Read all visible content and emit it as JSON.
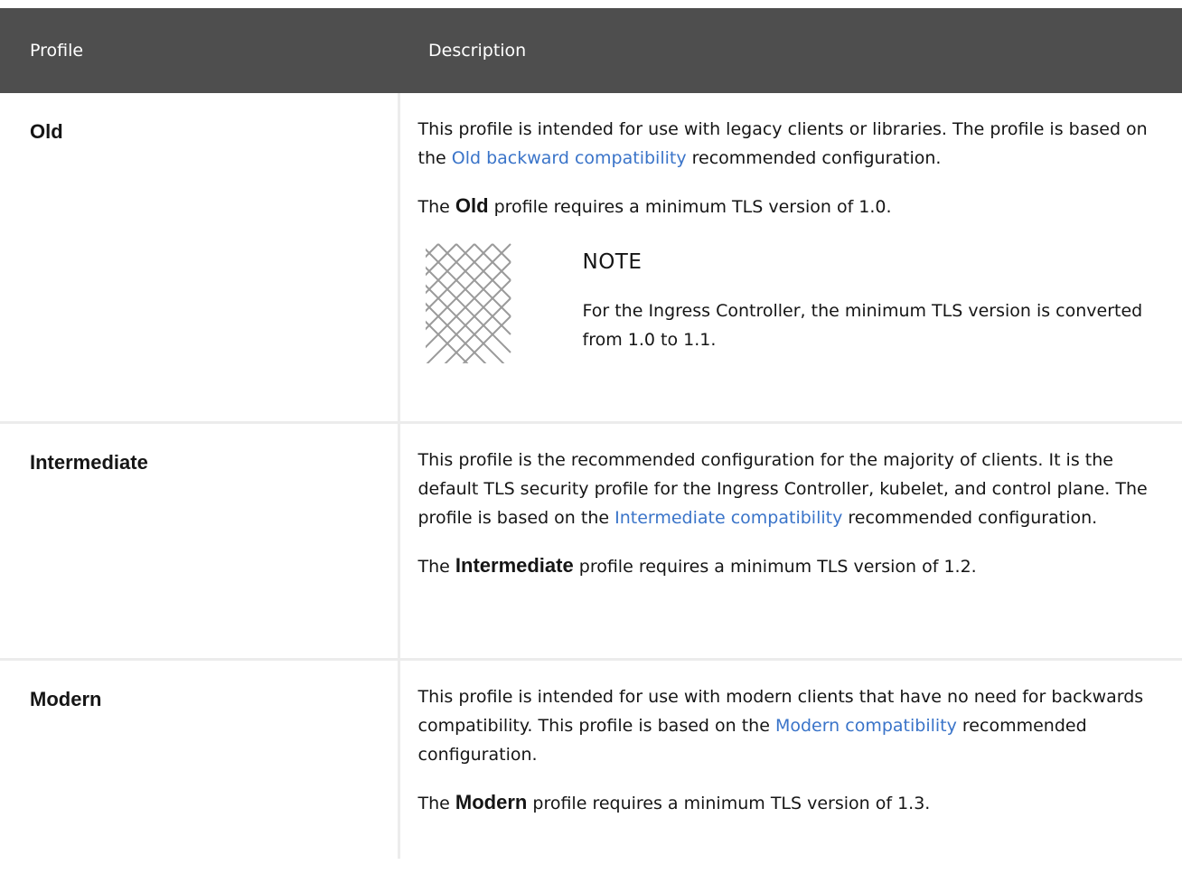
{
  "header": {
    "col_profile": "Profile",
    "col_description": "Description"
  },
  "rows": [
    {
      "profile": "Old",
      "para1_before": "This profile is intended for use with legacy clients or libraries. The profile is based on the ",
      "para1_link": "Old backward compatibility",
      "para1_after": " recommended configuration.",
      "para2_before": "The ",
      "para2_bold": "Old",
      "para2_after": " profile requires a minimum TLS version of 1.0.",
      "note": {
        "icon": "note-icon",
        "title": "NOTE",
        "text": "For the Ingress Controller, the minimum TLS version is converted from 1.0 to 1.1."
      }
    },
    {
      "profile": "Intermediate",
      "para1_before": "This profile is the recommended configuration for the majority of clients. It is the default TLS security profile for the Ingress Controller, kubelet, and control plane. The profile is based on the ",
      "para1_link": "Intermediate compatibility",
      "para1_after": " recommended configuration.",
      "para2_before": "The ",
      "para2_bold": "Intermediate",
      "para2_after": " profile requires a minimum TLS version of 1.2."
    },
    {
      "profile": "Modern",
      "para1_before": "This profile is intended for use with modern clients that have no need for backwards compatibility. This profile is based on the ",
      "para1_link": "Modern compatibility",
      "para1_after": " recommended configuration.",
      "para2_before": "The ",
      "para2_bold": "Modern",
      "para2_after": " profile requires a minimum TLS version of 1.3."
    }
  ],
  "colors": {
    "header_bg": "#4e4e4e",
    "link": "#3a74c9",
    "border": "#ececec"
  }
}
